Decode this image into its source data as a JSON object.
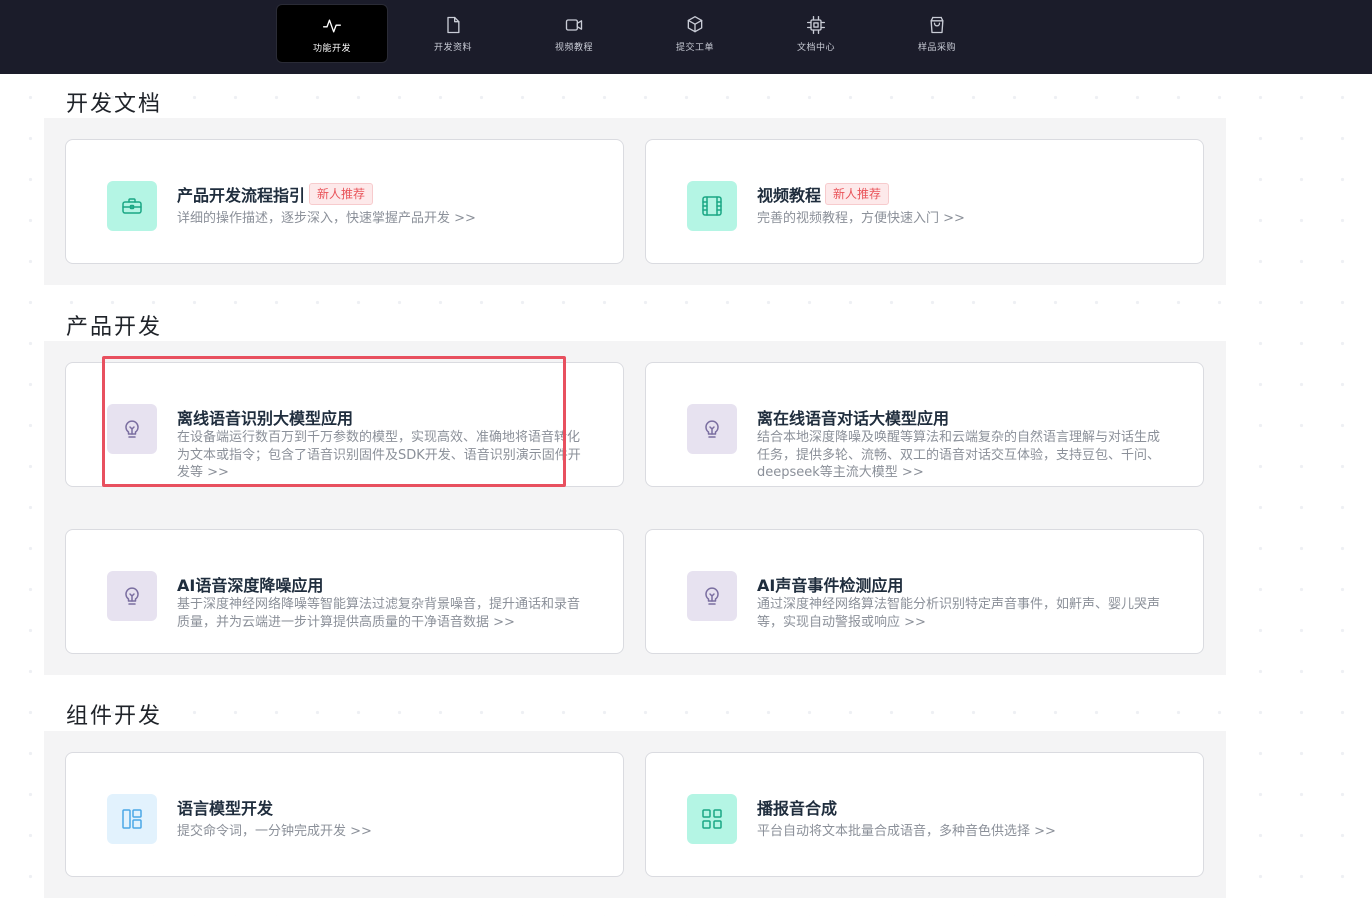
{
  "nav": {
    "items": [
      {
        "label": "功能开发",
        "icon": "activity-icon",
        "active": true
      },
      {
        "label": "开发资料",
        "icon": "file-icon",
        "active": false
      },
      {
        "label": "视频教程",
        "icon": "video-icon",
        "active": false
      },
      {
        "label": "提交工单",
        "icon": "box-icon",
        "active": false
      },
      {
        "label": "文档中心",
        "icon": "cpu-icon",
        "active": false
      },
      {
        "label": "样品采购",
        "icon": "shopping-bag-icon",
        "active": false
      }
    ]
  },
  "sections": {
    "docs": {
      "title": "开发文档",
      "cards": [
        {
          "title": "产品开发流程指引",
          "badge": "新人推荐",
          "desc": "详细的操作描述，逐步深入，快速掌握产品开发 >>",
          "icon": "toolbox-icon"
        },
        {
          "title": "视频教程",
          "badge": "新人推荐",
          "desc": "完善的视频教程，方便快速入门 >>",
          "icon": "film-icon"
        }
      ]
    },
    "product": {
      "title": "产品开发",
      "cards": [
        {
          "title": "离线语音识别大模型应用",
          "desc": "在设备端运行数百万到千万参数的模型，实现高效、准确地将语音转化为文本或指令；包含了语音识别固件及SDK开发、语音识别演示固件开发等 >>",
          "icon": "lightbulb-icon"
        },
        {
          "title": "离在线语音对话大模型应用",
          "desc": "结合本地深度降噪及唤醒等算法和云端复杂的自然语言理解与对话生成任务，提供多轮、流畅、双工的语音对话交互体验，支持豆包、千问、deepseek等主流大模型 >>",
          "icon": "lightbulb-icon"
        },
        {
          "title": "AI语音深度降噪应用",
          "desc": "基于深度神经网络降噪等智能算法过滤复杂背景噪音，提升通话和录音质量，并为云端进一步计算提供高质量的干净语音数据 >>",
          "icon": "lightbulb-icon"
        },
        {
          "title": "AI声音事件检测应用",
          "desc": "通过深度神经网络算法智能分析识别特定声音事件，如鼾声、婴儿哭声等，实现自动警报或响应 >>",
          "icon": "lightbulb-icon"
        }
      ]
    },
    "component": {
      "title": "组件开发",
      "cards": [
        {
          "title": "语言模型开发",
          "desc": "提交命令词，一分钟完成开发 >>",
          "icon": "layout-icon"
        },
        {
          "title": "播报音合成",
          "desc": "平台自动将文本批量合成语音，多种音色供选择 >>",
          "icon": "grid-icon"
        }
      ]
    }
  },
  "colors": {
    "nav_bg": "#1b1c2a",
    "panel_bg": "#f4f4f5",
    "badge_red": "#e9545a",
    "highlight_red": "#e8505f",
    "icon_green": "#1aa784",
    "icon_purple": "#7a6ea0",
    "icon_blue": "#4aa7e6"
  }
}
